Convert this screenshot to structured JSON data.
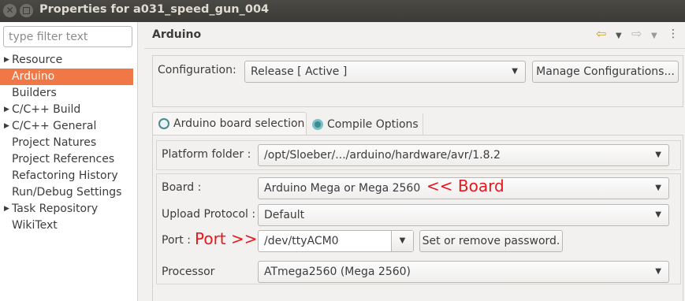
{
  "window": {
    "title": "Properties for a031_speed_gun_004",
    "close_glyph": "✕"
  },
  "filter": {
    "placeholder": "type filter text"
  },
  "tree": [
    {
      "label": "Resource",
      "expandable": true
    },
    {
      "label": "Arduino",
      "expandable": false,
      "selected": true
    },
    {
      "label": "Builders",
      "expandable": false
    },
    {
      "label": "C/C++ Build",
      "expandable": true
    },
    {
      "label": "C/C++ General",
      "expandable": true
    },
    {
      "label": "Project Natures",
      "expandable": false
    },
    {
      "label": "Project References",
      "expandable": false
    },
    {
      "label": "Refactoring History",
      "expandable": false
    },
    {
      "label": "Run/Debug Settings",
      "expandable": false
    },
    {
      "label": "Task Repository",
      "expandable": true
    },
    {
      "label": "WikiText",
      "expandable": false
    }
  ],
  "section": {
    "title": "Arduino"
  },
  "nav": {
    "back_icon": "⇦",
    "forward_icon": "⇨",
    "dropdown_icon": "▼",
    "menu_icon": "⋮"
  },
  "config": {
    "label": "Configuration:",
    "value": "Release  [ Active ]",
    "manage_button": "Manage Configurations..."
  },
  "tabs": [
    {
      "label": "Arduino board selection",
      "active": true
    },
    {
      "label": "Compile Options",
      "active": false
    }
  ],
  "fields": {
    "platform_label": "Platform folder :",
    "platform_value": "/opt/Sloeber/.../arduino/hardware/avr/1.8.2",
    "board_label": "Board :",
    "board_value": "Arduino Mega or Mega 2560",
    "board_note": "<< Board",
    "upload_label": "Upload Protocol :",
    "upload_value": "Default",
    "port_label": "Port :",
    "port_note": "Port >>",
    "port_value": "/dev/ttyACM0",
    "password_button": "Set or remove password.",
    "processor_label": "Processor",
    "processor_value": "ATmega2560 (Mega 2560)"
  },
  "colors": {
    "selection": "#f07746",
    "annotation": "#e8161b",
    "titlebar": "#3c3b37"
  }
}
